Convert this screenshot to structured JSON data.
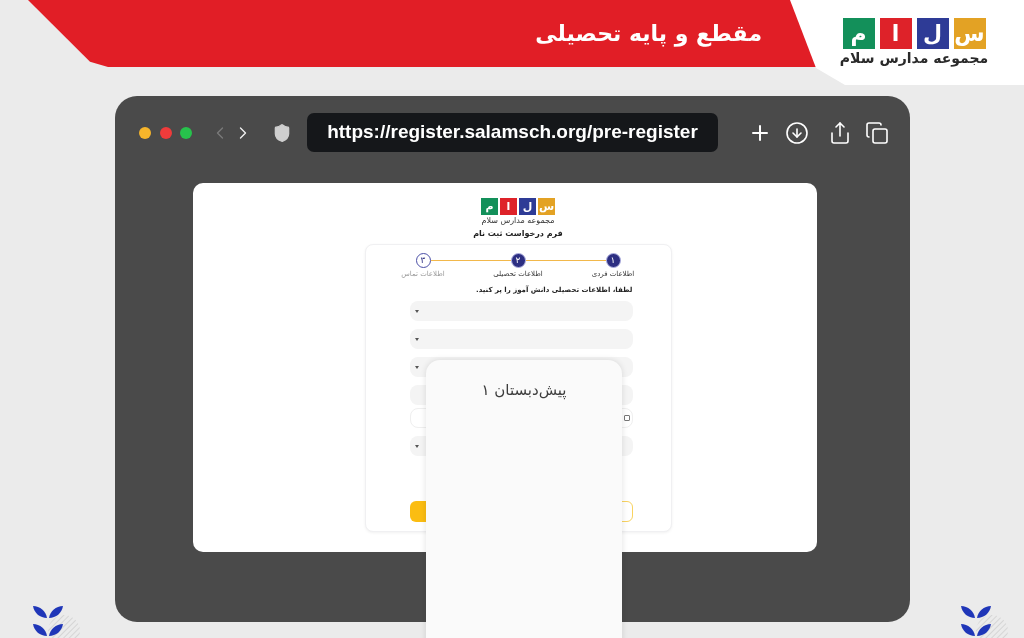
{
  "header": {
    "title": "مقطع و پایه تحصیلی",
    "logo": {
      "tiles": [
        {
          "letter": "س",
          "color": "#e3a224"
        },
        {
          "letter": "ل",
          "color": "#2e3b96"
        },
        {
          "letter": "ا",
          "color": "#de2229"
        },
        {
          "letter": "م",
          "color": "#13905a"
        }
      ],
      "name": "مجموعه مدارس سلام"
    }
  },
  "browser": {
    "back": {
      "disabled": true
    },
    "forward": {
      "disabled": false
    },
    "url": "https://register.salamsch.org/pre-register"
  },
  "page": {
    "logo": {
      "tiles": [
        {
          "letter": "س",
          "color": "#e3a224"
        },
        {
          "letter": "ل",
          "color": "#2e3b96"
        },
        {
          "letter": "ا",
          "color": "#de2229"
        },
        {
          "letter": "م",
          "color": "#13905a"
        }
      ],
      "name": "مجموعه مدارس سلام"
    },
    "title": "فرم درخواست ثبت نام",
    "steps": [
      {
        "number": "۱",
        "label": "اطلاعات فردی",
        "active": true
      },
      {
        "number": "۲",
        "label": "اطلاعات تحصیلی",
        "active": true
      },
      {
        "number": "۳",
        "label": "اطلاعات تماس",
        "active": false
      }
    ],
    "instruction": "لطفا، اطلاعات تحصیلی دانش آموز را پر کنید.",
    "fields": [
      {
        "kind": "select"
      },
      {
        "kind": "select"
      },
      {
        "kind": "select"
      },
      {
        "kind": "input"
      },
      {
        "kind": "checkbox",
        "checked": false
      },
      {
        "kind": "select"
      }
    ],
    "buttons": [
      {
        "kind": "outline"
      },
      {
        "kind": "filled"
      }
    ]
  },
  "dropdown": {
    "options": [
      "پیش‌دبستان ۱"
    ]
  }
}
